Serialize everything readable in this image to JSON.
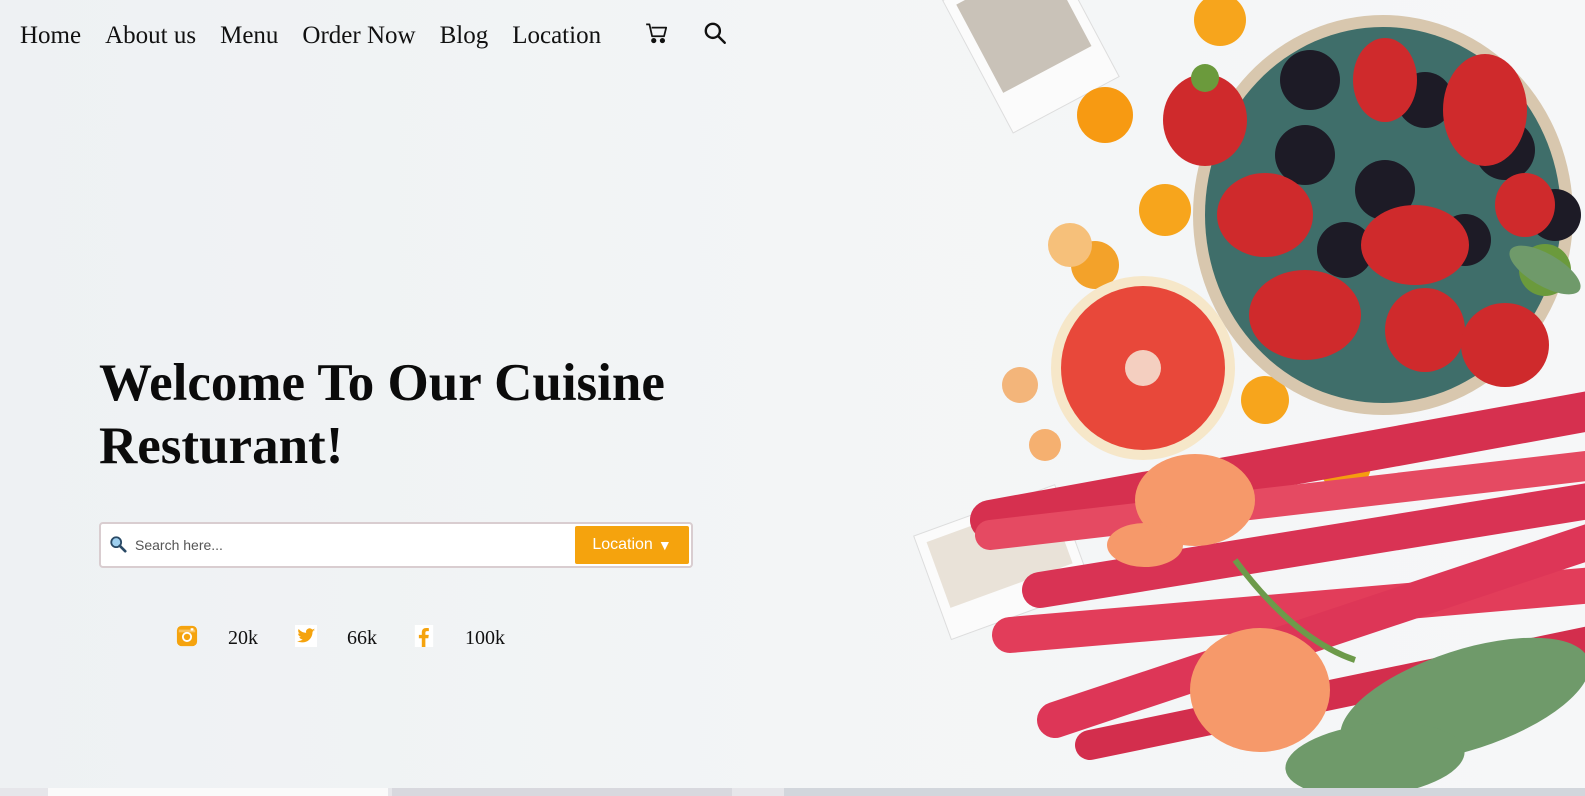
{
  "nav": {
    "items": [
      {
        "label": "Home"
      },
      {
        "label": "About us"
      },
      {
        "label": "Menu"
      },
      {
        "label": "Order Now"
      },
      {
        "label": "Blog"
      },
      {
        "label": "Location"
      }
    ],
    "icons": [
      "cart-icon",
      "search-icon"
    ]
  },
  "hero": {
    "title_line1": "Welcome To Our Cuisine",
    "title_line2": "Resturant!"
  },
  "search": {
    "placeholder": "Search here...",
    "value": "",
    "location_label": "Location",
    "location_caret": "▼"
  },
  "social": [
    {
      "icon": "instagram-icon",
      "count": "20k"
    },
    {
      "icon": "twitter-icon",
      "count": "66k"
    },
    {
      "icon": "facebook-icon",
      "count": "100k"
    }
  ],
  "colors": {
    "accent": "#f5a30d",
    "text": "#111111",
    "background": "#f1f3f4"
  }
}
